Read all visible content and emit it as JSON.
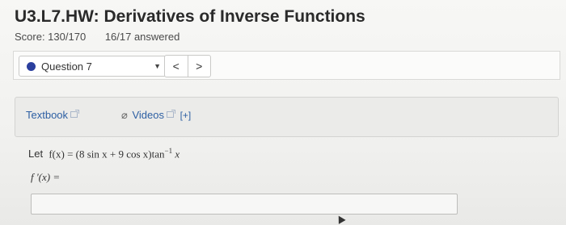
{
  "header": {
    "title": "U3.L7.HW: Derivatives of Inverse Functions",
    "score": "Score: 130/170",
    "answered": "16/17 answered"
  },
  "question_nav": {
    "selected_question": "Question 7",
    "caret": "▼",
    "prev_label": "<",
    "next_label": ">"
  },
  "resources": {
    "textbook_label": "Textbook",
    "videos_label": "Videos",
    "expand_label": "[+]"
  },
  "problem": {
    "lead": "Let",
    "expression": "f(x) = (8 sin x + 9 cos x)tan",
    "exponent": "−1",
    "variable": "x",
    "derivative_label": "f '(x) ="
  },
  "answer": {
    "value": ""
  },
  "colors": {
    "link": "#2d5fa3",
    "question_dot": "#2b3f9e",
    "panel_bg": "#ebebe9"
  }
}
